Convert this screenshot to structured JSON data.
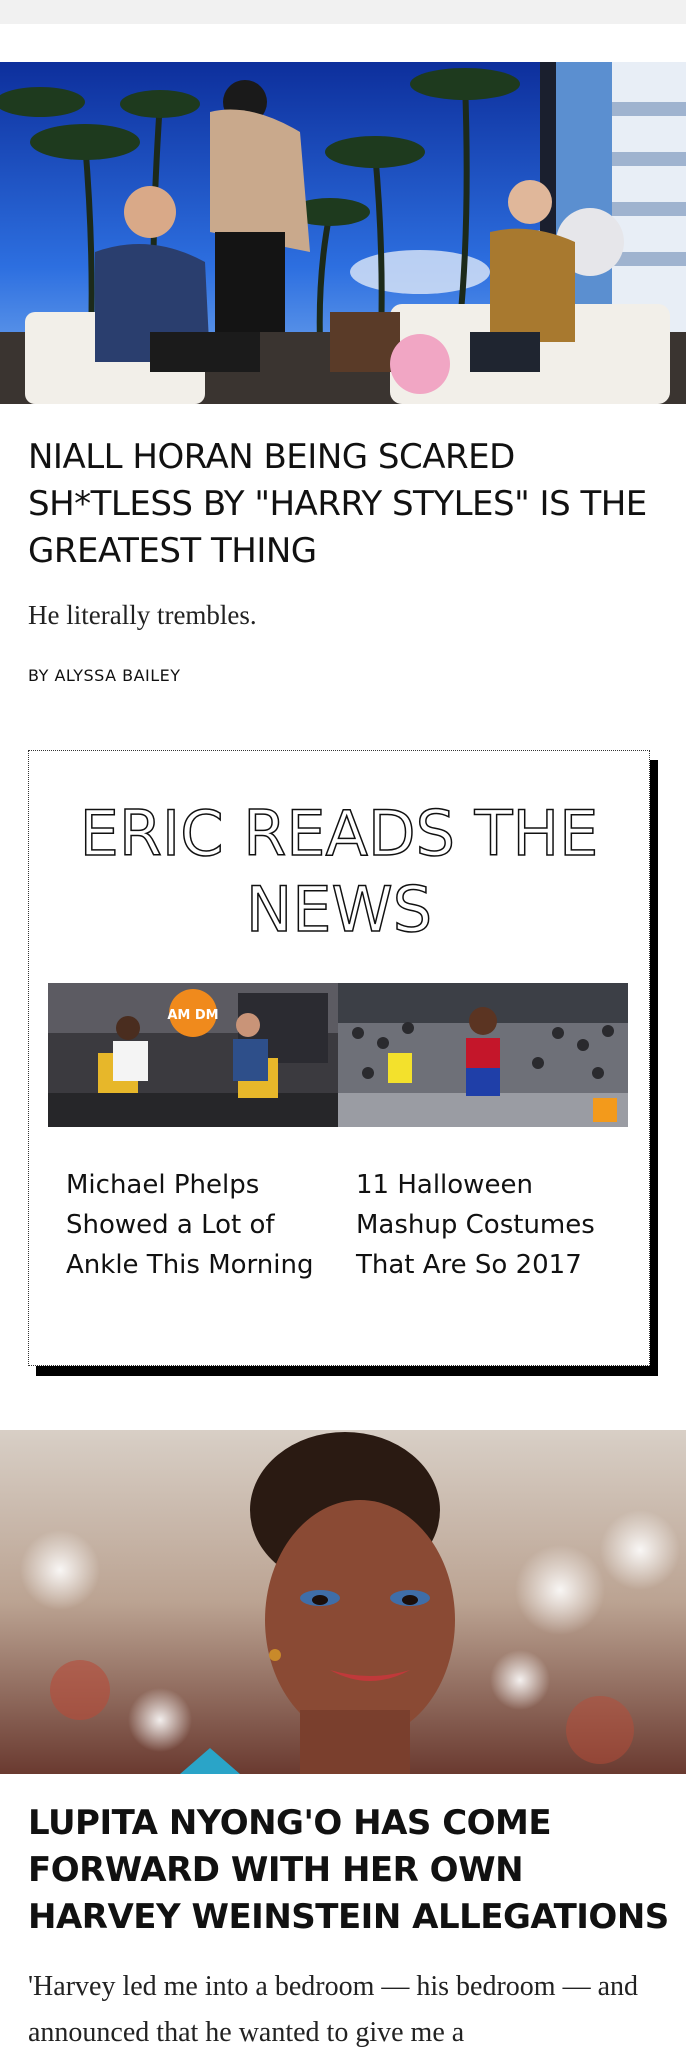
{
  "articles": [
    {
      "title": "NIALL HORAN BEING SCARED SH*TLESS BY \"HARRY STYLES\" IS THE GREATEST THING",
      "dek": "He literally trembles.",
      "byline": "BY ALYSSA BAILEY",
      "image_icon": "talk-show-photo"
    },
    {
      "title": "LUPITA NYONG'O HAS COME FORWARD WITH HER OWN HARVEY WEINSTEIN ALLEGATIONS",
      "dek": "'Harvey led me into a bedroom — his bedroom — and announced that he wanted to give me a",
      "image_icon": "portrait-photo"
    }
  ],
  "module": {
    "title": "ERIC READS THE NEWS",
    "title_line1": "ERIC READS THE",
    "title_line2": "NEWS",
    "stories": [
      {
        "headline": "Michael Phelps Showed a Lot of Ankle This Morning",
        "image_icon": "tv-studio-photo",
        "badge_text": "AM DM"
      },
      {
        "headline": "11 Halloween Mashup Costumes That Are So 2017",
        "image_icon": "costume-crowd-photo"
      }
    ]
  },
  "colors": {
    "sky": "#1f5fcf",
    "module_shadow": "#000000"
  }
}
